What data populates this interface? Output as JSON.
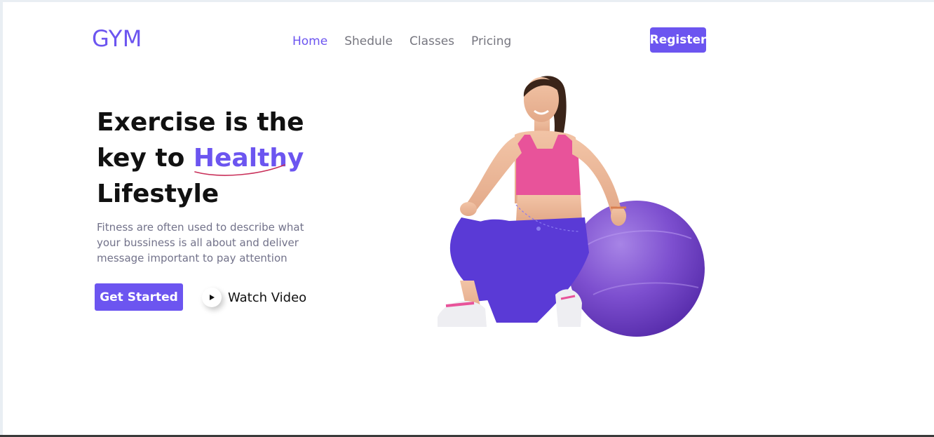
{
  "brand": {
    "logo_text": "GYM",
    "accent_color": "#6c55f0"
  },
  "nav": {
    "items": [
      {
        "label": "Home",
        "active": true
      },
      {
        "label": "Shedule",
        "active": false
      },
      {
        "label": "Classes",
        "active": false
      },
      {
        "label": "Pricing",
        "active": false
      }
    ],
    "register_label": "Register"
  },
  "hero": {
    "title_line1": "Exercise is the",
    "title_line2_prefix": "key to",
    "title_highlight": "Healthy",
    "title_line3": "Lifestyle",
    "description": "Fitness are often used to describe what your bussiness is all about and deliver message important to pay attention",
    "primary_button_label": "Get Started",
    "secondary_button_label": "Watch Video",
    "secondary_button_icon": "play-icon",
    "image_subject": "woman-with-exercise-ball"
  }
}
